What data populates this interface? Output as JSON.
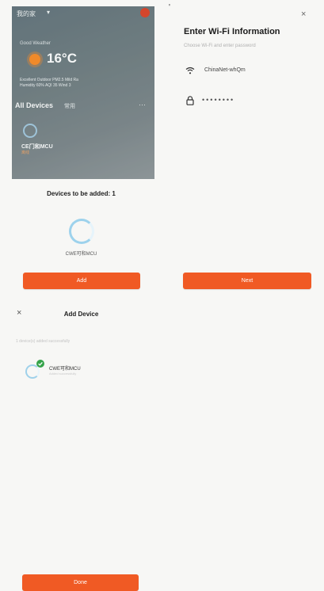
{
  "home_screen": {
    "top_title": "我的家",
    "top_arrow": "▾",
    "weather_sub": "Good Weather",
    "temperature": "16°C",
    "weather_row_1": "Excellent     Outdoor PM2.5     Mild Ra",
    "weather_row_2": "Humidity 60%    AQI 35      Wind 3",
    "all_devices": "All Devices",
    "all_devices_sub": "常用",
    "more_dots": "···",
    "device_name": "CE门和MCU",
    "device_status": "离线"
  },
  "devices_panel": {
    "title": "Devices to be added: 1",
    "device_label": "CWE可和MCU",
    "add_label": "Add"
  },
  "wifi_panel": {
    "corner_mark": "'",
    "close": "×",
    "title": "Enter Wi-Fi Information",
    "subtitle": "Choose Wi-Fi and enter password",
    "ssid": "ChinaNet-whQm",
    "password": "••••••••",
    "next_label": "Next"
  },
  "add_device_panel": {
    "close": "×",
    "title": "Add Device",
    "hint": "1 device(s) added successfully",
    "device_name": "CWE可和MCU",
    "device_sub": "Added successfully",
    "done_label": "Done"
  },
  "colors": {
    "accent": "#f05a24",
    "success": "#35a34a",
    "ring": "#9dd2ec"
  },
  "icons": {
    "wifi": "wifi-icon",
    "lock": "lock-icon",
    "close": "close-icon",
    "check": "check-icon",
    "sun": "sun-icon"
  }
}
